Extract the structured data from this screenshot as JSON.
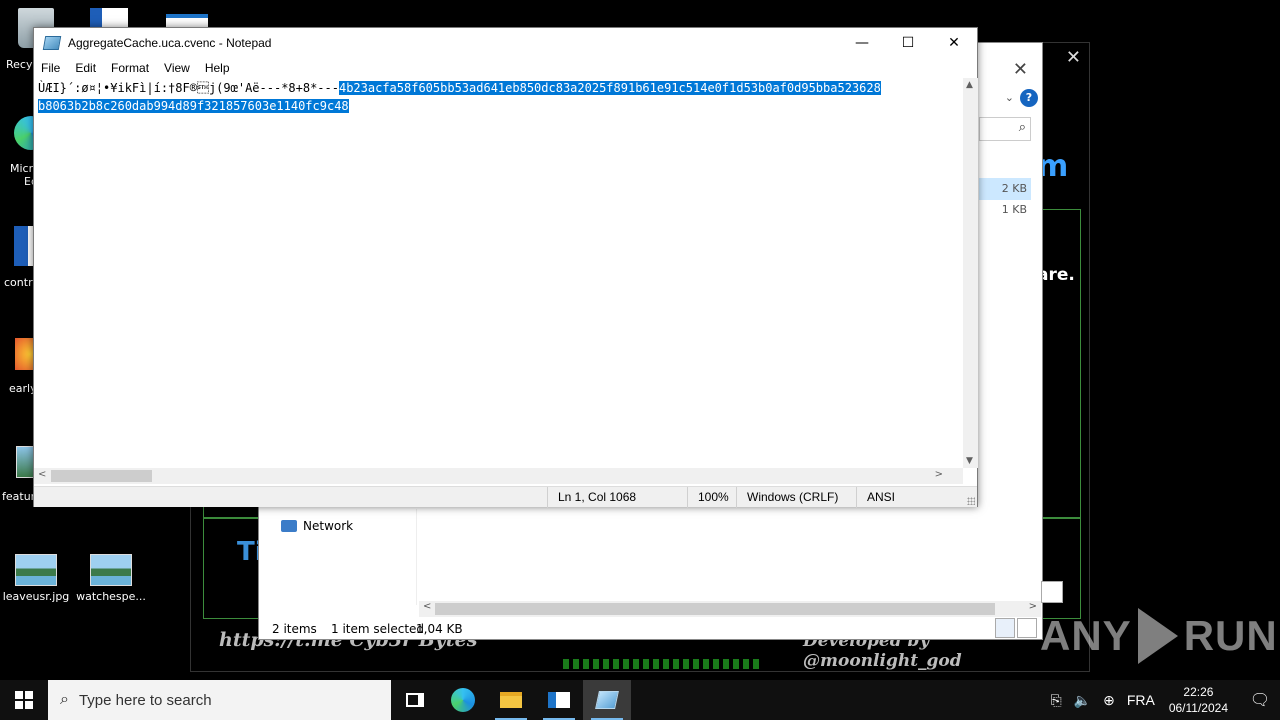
{
  "notepad": {
    "title": "AggregateCache.uca.cvenc - Notepad",
    "menu": [
      "File",
      "Edit",
      "Format",
      "View",
      "Help"
    ],
    "line1_plain": "ÙÆI}´:ø¤¦•¥ikFì|í:†8F®\u0002j(9œ'Aë---*8+8*---",
    "line1_selected": "4b23acfa58f605bb53ad641eb850dc83a2025f891b61e91c514e0f1d53b0af0d95bba523628",
    "line2_selected": "b8063b2b8c260dab994d89f321857603e1140fc9c48",
    "status": {
      "position": "Ln 1, Col 1068",
      "zoom": "100%",
      "line_ending": "Windows (CRLF)",
      "encoding": "ANSI"
    }
  },
  "explorer": {
    "nav_network": "Network",
    "sizes": [
      "2 KB",
      "1 KB"
    ],
    "status_items": "2 items",
    "status_selected": "1 item selected",
    "status_size": "1,04 KB"
  },
  "background_app": {
    "partial_m": "m",
    "partial_are": "are.",
    "partial_ti": "Ti",
    "footer_left": "https://t.me  Cyb3r Bytes",
    "footer_right": "Developed by @moonlight_god"
  },
  "desktop": {
    "icons": [
      {
        "label": "Recy",
        "icon": "recycle-bin-icon"
      },
      {
        "label": "Micr",
        "icon": "edge-shortcut-icon"
      },
      {
        "label": "Ec",
        "icon": "edge-shortcut-icon"
      },
      {
        "label": "contra",
        "icon": "word-document-icon"
      },
      {
        "label": "early",
        "icon": "image-file-icon"
      },
      {
        "label": "featur",
        "icon": "image-file-icon"
      },
      {
        "label": "leaveusr.jpg",
        "icon": "image-file-icon"
      },
      {
        "label": "watchespe...",
        "icon": "image-file-icon"
      }
    ]
  },
  "watermark": {
    "left": "ANY",
    "right": "RUN"
  },
  "taskbar": {
    "search_placeholder": "Type here to search",
    "language": "FRA",
    "time": "22:26",
    "date": "06/11/2024"
  }
}
